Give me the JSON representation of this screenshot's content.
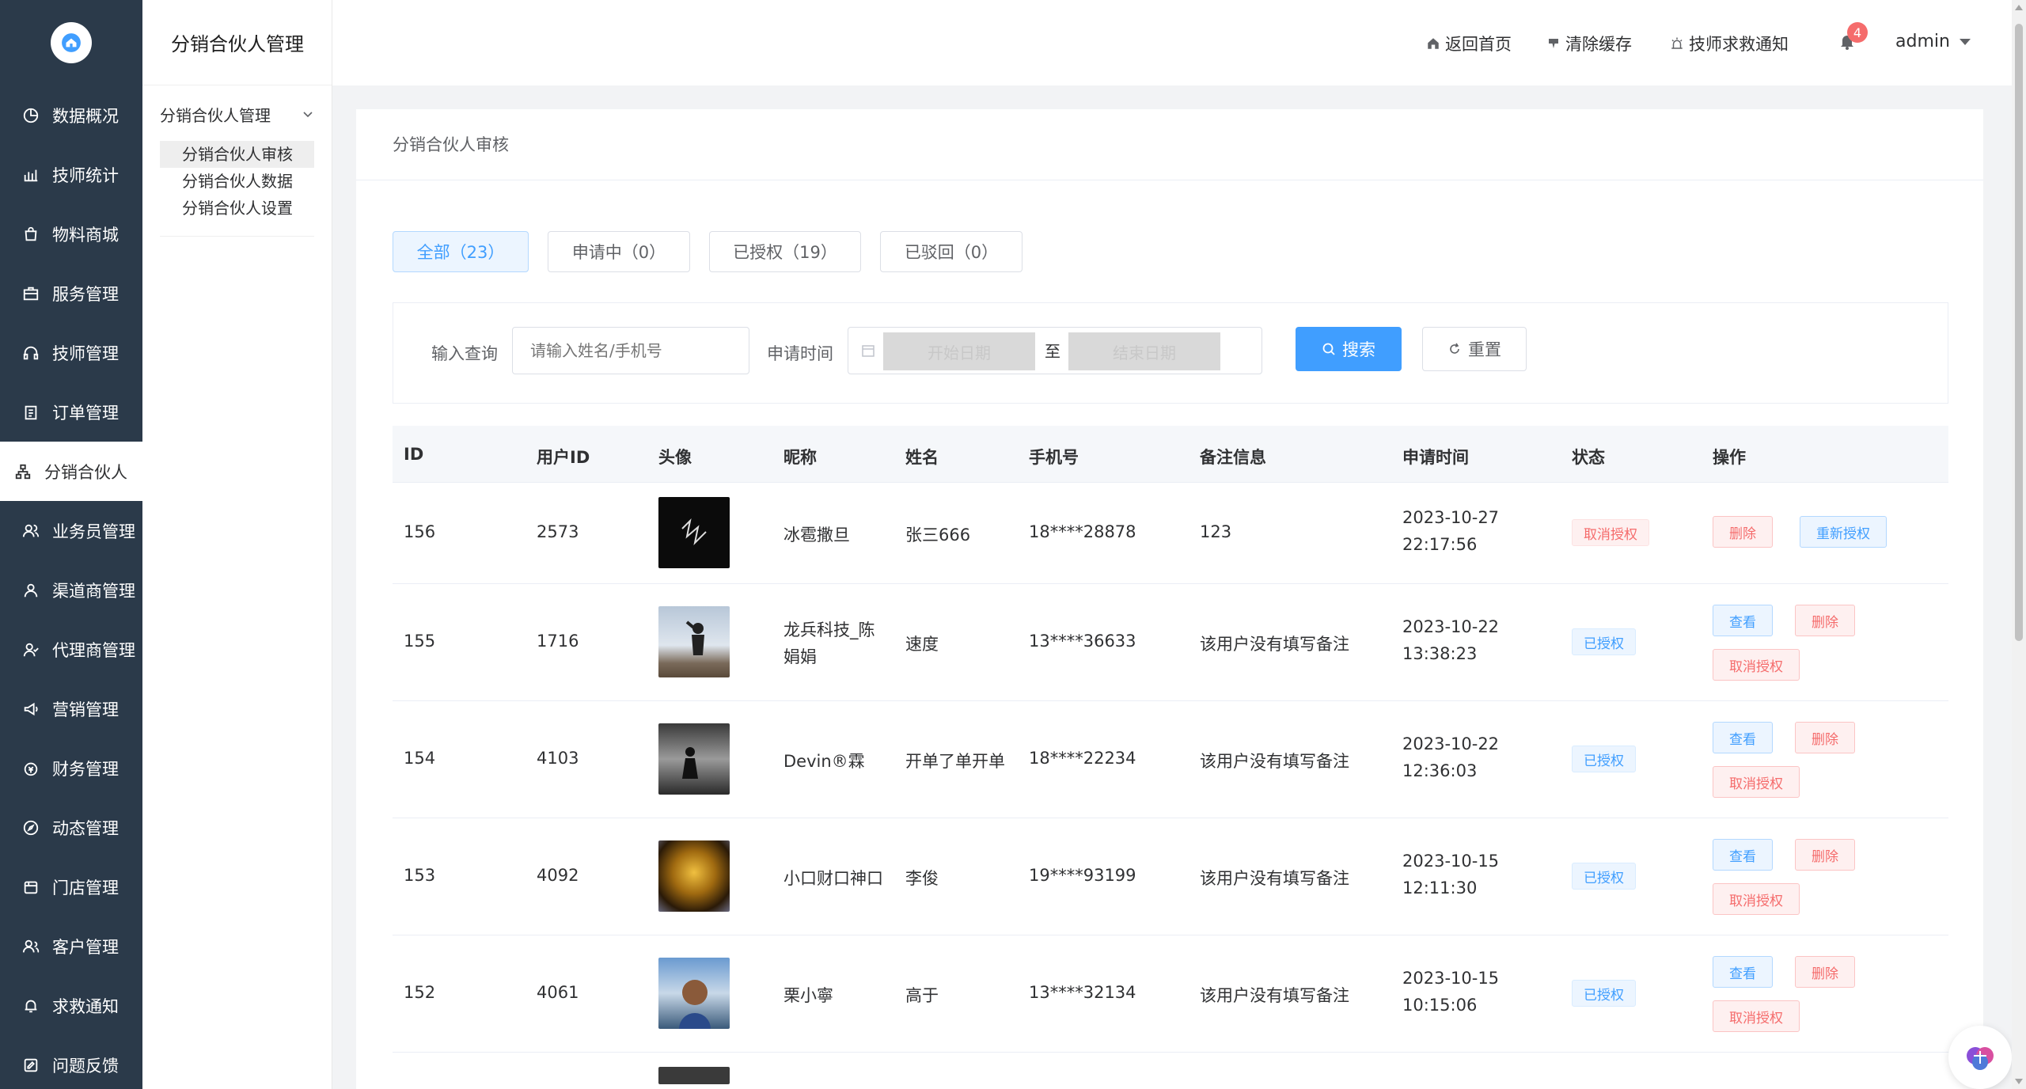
{
  "nav": {
    "items": [
      {
        "label": "数据概况",
        "icon": "pie-chart-icon"
      },
      {
        "label": "技师统计",
        "icon": "bar-chart-icon"
      },
      {
        "label": "物料商城",
        "icon": "shopping-bag-icon"
      },
      {
        "label": "服务管理",
        "icon": "briefcase-icon"
      },
      {
        "label": "技师管理",
        "icon": "headset-icon"
      },
      {
        "label": "订单管理",
        "icon": "clipboard-icon"
      },
      {
        "label": "分销合伙人",
        "icon": "network-icon"
      },
      {
        "label": "业务员管理",
        "icon": "users-icon"
      },
      {
        "label": "渠道商管理",
        "icon": "user-icon"
      },
      {
        "label": "代理商管理",
        "icon": "user-check-icon"
      },
      {
        "label": "营销管理",
        "icon": "megaphone-icon"
      },
      {
        "label": "财务管理",
        "icon": "wallet-icon"
      },
      {
        "label": "动态管理",
        "icon": "compass-icon"
      },
      {
        "label": "门店管理",
        "icon": "store-icon"
      },
      {
        "label": "客户管理",
        "icon": "customers-icon"
      },
      {
        "label": "求救通知",
        "icon": "bell-icon"
      },
      {
        "label": "问题反馈",
        "icon": "feedback-icon"
      }
    ]
  },
  "sub": {
    "title": "分销合伙人管理",
    "group_title": "分销合伙人管理",
    "items": [
      "分销合伙人审核",
      "分销合伙人数据",
      "分销合伙人设置"
    ]
  },
  "topbar": {
    "home": "返回首页",
    "clear_cache": "清除缓存",
    "sos": "技师求救通知",
    "badge": "4",
    "user": "admin"
  },
  "card": {
    "title": "分销合伙人审核",
    "tabs": [
      "全部（23）",
      "申请中（0）",
      "已授权（19）",
      "已驳回（0）"
    ],
    "search": {
      "query_label": "输入查询",
      "query_placeholder": "请输入姓名/手机号",
      "time_label": "申请时间",
      "start_placeholder": "开始日期",
      "to": "至",
      "end_placeholder": "结束日期",
      "search_btn": "搜索",
      "reset_btn": "重置"
    }
  },
  "table": {
    "headers": [
      "ID",
      "用户ID",
      "头像",
      "昵称",
      "姓名",
      "手机号",
      "备注信息",
      "申请时间",
      "状态",
      "操作"
    ],
    "rows": [
      {
        "id": "156",
        "uid": "2573",
        "nick1": "冰雹撒旦",
        "nick2": "",
        "name": "张三666",
        "phone": "18****28878",
        "note": "123",
        "date": "2023-10-27",
        "time": "22:17:56",
        "status": "取消授权",
        "actions": [
          "删除",
          "重新授权"
        ]
      },
      {
        "id": "155",
        "uid": "1716",
        "nick1": "龙兵科技_陈",
        "nick2": "娟娟",
        "name": "速度",
        "phone": "13****36633",
        "note": "该用户没有填写备注",
        "date": "2023-10-22",
        "time": "13:38:23",
        "status": "已授权",
        "actions": [
          "查看",
          "删除",
          "取消授权"
        ]
      },
      {
        "id": "154",
        "uid": "4103",
        "nick1": "Devin®霖",
        "nick2": "",
        "name": "开单了单开单",
        "phone": "18****22234",
        "note": "该用户没有填写备注",
        "date": "2023-10-22",
        "time": "12:36:03",
        "status": "已授权",
        "actions": [
          "查看",
          "删除",
          "取消授权"
        ]
      },
      {
        "id": "153",
        "uid": "4092",
        "nick1": "小口财口神口",
        "nick2": "",
        "name": "李俊",
        "phone": "19****93199",
        "note": "该用户没有填写备注",
        "date": "2023-10-15",
        "time": "12:11:30",
        "status": "已授权",
        "actions": [
          "查看",
          "删除",
          "取消授权"
        ]
      },
      {
        "id": "152",
        "uid": "4061",
        "nick1": "栗小寧",
        "nick2": "",
        "name": "高于",
        "phone": "13****32134",
        "note": "该用户没有填写备注",
        "date": "2023-10-15",
        "time": "10:15:06",
        "status": "已授权",
        "actions": [
          "查看",
          "删除",
          "取消授权"
        ]
      }
    ]
  }
}
